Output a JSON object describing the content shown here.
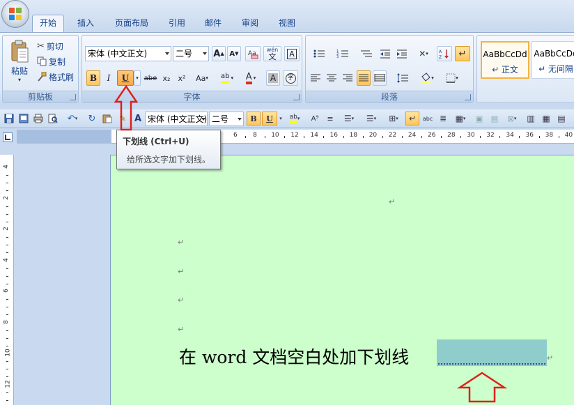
{
  "tabs": [
    {
      "label": "开始",
      "active": true
    },
    {
      "label": "插入"
    },
    {
      "label": "页面布局"
    },
    {
      "label": "引用"
    },
    {
      "label": "邮件"
    },
    {
      "label": "审阅"
    },
    {
      "label": "视图"
    }
  ],
  "clipboard": {
    "paste_label": "粘贴",
    "cut_label": "剪切",
    "copy_label": "复制",
    "format_painter_label": "格式刷",
    "group_label": "剪贴板"
  },
  "font": {
    "font_name": "宋体 (中文正文)",
    "font_size": "二号",
    "bold": "B",
    "italic": "I",
    "underline": "U",
    "strikethrough": "abe",
    "subscript": "x₂",
    "superscript": "x²",
    "change_case": "Aa",
    "highlight": "ab",
    "font_color": "A",
    "char_shading": "A",
    "enclose": "字",
    "grow": "A",
    "shrink": "A",
    "phonetic": "wén",
    "group_label": "字体"
  },
  "paragraph": {
    "group_label": "段落"
  },
  "styles": [
    {
      "preview": "AaBbCcDd",
      "name": "↵ 正文"
    },
    {
      "preview": "AaBbCcDd",
      "name": "↵ 无间隔"
    }
  ],
  "qat": {
    "font_name": "宋体 (中文正文)",
    "font_size": "二号",
    "bold": "B",
    "underline": "U"
  },
  "tooltip": {
    "title": "下划线 (Ctrl+U)",
    "body": "给所选文字加下划线。"
  },
  "hruler": [
    "6",
    "8",
    "10",
    "12",
    "14",
    "16",
    "18",
    "20",
    "22",
    "24",
    "26",
    "28",
    "30",
    "32",
    "34",
    "36",
    "38",
    "40"
  ],
  "vruler": [
    "4",
    "2",
    "2",
    "4",
    "6",
    "8",
    "10",
    "12"
  ],
  "document": {
    "text": "在 word 文档空白处加下划线",
    "para_mark": "↵"
  },
  "colors": {
    "page": "#ccffcc",
    "selection": "#8fcccc",
    "arrow": "#e0201b",
    "hot": "#ffc45c"
  }
}
